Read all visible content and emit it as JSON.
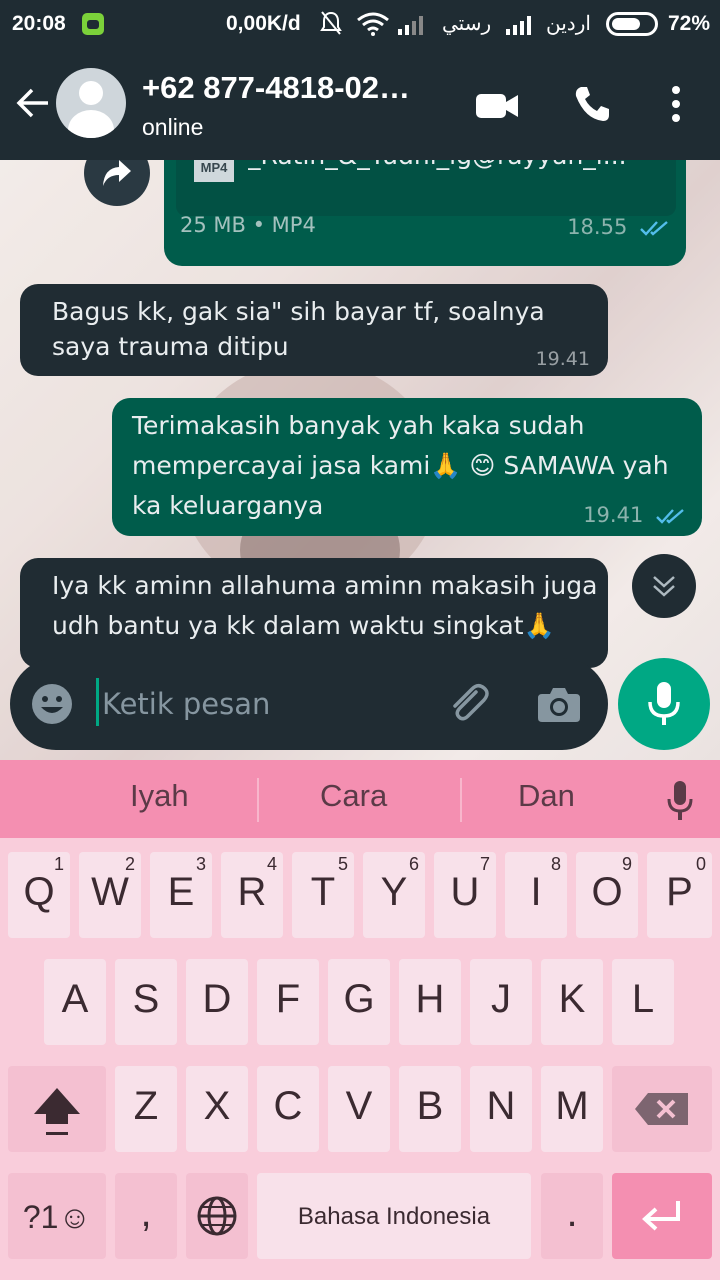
{
  "status_bar": {
    "time": "20:08",
    "network_speed": "0,00K/d",
    "operator_1": "رستي",
    "operator_2": "اردين",
    "battery_percent": "72%",
    "battery_level": 0.72
  },
  "header": {
    "contact_name": "+62 877-4818-02…",
    "presence": "online"
  },
  "messages": [
    {
      "type": "file",
      "direction": "outgoing",
      "file_type_badge": "MP4",
      "file_name": "_Ratih_&_Yudhi_ig@rayyan_i...",
      "file_info": "25 MB • MP4",
      "time": "18.55",
      "read": true
    },
    {
      "type": "text",
      "direction": "incoming",
      "text": "Bagus kk, gak sia\" sih bayar tf, soalnya saya trauma ditipu",
      "time": "19.41"
    },
    {
      "type": "text",
      "direction": "outgoing",
      "text": "Terimakasih banyak yah kaka sudah mempercayai jasa kami🙏 😊 SAMAWA yah ka keluarganya",
      "time": "19.41",
      "read": true
    },
    {
      "type": "text",
      "direction": "incoming",
      "text": "Iya kk aminn allahuma aminn makasih juga udh bantu ya kk dalam waktu singkat🙏",
      "time": ""
    }
  ],
  "composer": {
    "placeholder": "Ketik pesan"
  },
  "keyboard": {
    "suggestions": [
      "Iyah",
      "Cara",
      "Dan"
    ],
    "row1": [
      {
        "key": "Q",
        "num": "1"
      },
      {
        "key": "W",
        "num": "2"
      },
      {
        "key": "E",
        "num": "3"
      },
      {
        "key": "R",
        "num": "4"
      },
      {
        "key": "T",
        "num": "5"
      },
      {
        "key": "Y",
        "num": "6"
      },
      {
        "key": "U",
        "num": "7"
      },
      {
        "key": "I",
        "num": "8"
      },
      {
        "key": "O",
        "num": "9"
      },
      {
        "key": "P",
        "num": "0"
      }
    ],
    "row2": [
      "A",
      "S",
      "D",
      "F",
      "G",
      "H",
      "J",
      "K",
      "L"
    ],
    "row3": [
      "Z",
      "X",
      "C",
      "V",
      "B",
      "N",
      "M"
    ],
    "symbols_key": "?1☺",
    "comma_key": ",",
    "space_label": "Bahasa Indonesia",
    "period_key": "."
  },
  "colors": {
    "header_bg": "#1f2c33",
    "incoming_bubble": "#202c33",
    "outgoing_bubble": "#005c4b",
    "accent": "#00a884",
    "keyboard_bg": "#f9cddb",
    "suggestion_bar": "#f48fb1"
  },
  "icons": [
    "back-arrow-icon",
    "avatar-icon",
    "video-call-icon",
    "phone-icon",
    "more-vert-icon",
    "forward-icon",
    "double-check-icon",
    "scroll-down-icon",
    "emoji-icon",
    "attach-icon",
    "camera-icon",
    "mic-icon",
    "shift-icon",
    "backspace-icon",
    "globe-icon",
    "enter-icon"
  ]
}
